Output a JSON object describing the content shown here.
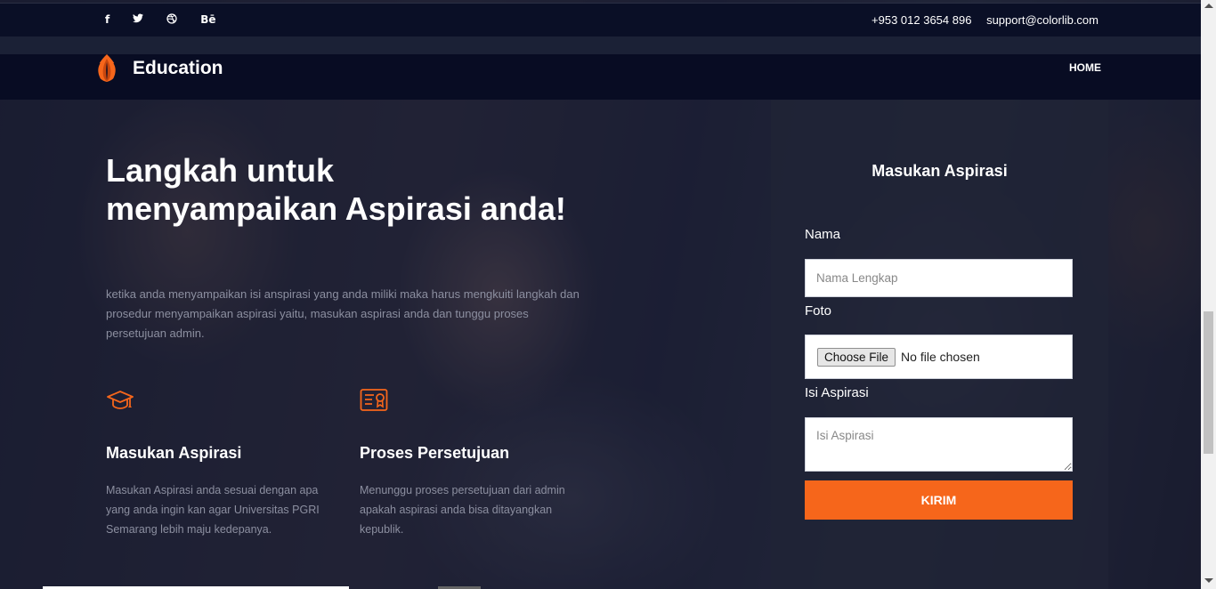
{
  "topbar": {
    "social": [
      {
        "icon": "facebook-icon",
        "glyph": "f"
      },
      {
        "icon": "twitter-icon",
        "glyph": "🐦"
      },
      {
        "icon": "dribbble-icon",
        "glyph": "⊛"
      },
      {
        "icon": "behance-icon",
        "glyph": "Bē"
      }
    ],
    "phone": "+953 012 3654 896",
    "email": "support@colorlib.com"
  },
  "navbar": {
    "logo_text": "Education",
    "home_label": "HOME"
  },
  "hero": {
    "title": "Langkah untuk menyampaikan Aspirasi anda!",
    "description": "ketika anda menyampaikan isi anspirasi yang anda miliki maka harus mengkuiti langkah dan prosedur menyampaikan aspirasi yaitu, masukan aspirasi anda dan tunggu proses persetujuan admin."
  },
  "features": [
    {
      "icon": "graduation-cap-icon",
      "title": "Masukan Aspirasi",
      "text": "Masukan Aspirasi anda sesuai dengan apa yang anda ingin kan agar Universitas PGRI Semarang lebih maju kedepanya."
    },
    {
      "icon": "certificate-icon",
      "title": "Proses Persetujuan",
      "text": "Menunggu proses persetujuan dari admin apakah aspirasi anda bisa ditayangkan kepublik."
    }
  ],
  "form": {
    "title": "Masukan Aspirasi",
    "nama_label": "Nama",
    "nama_placeholder": "Nama Lengkap",
    "foto_label": "Foto",
    "file_button": "Choose File",
    "file_status": "No file chosen",
    "isi_label": "Isi Aspirasi",
    "isi_placeholder": "Isi Aspirasi",
    "submit_label": "KIRIM"
  },
  "colors": {
    "accent": "#f6661b",
    "navbar_bg": "#080c23"
  }
}
